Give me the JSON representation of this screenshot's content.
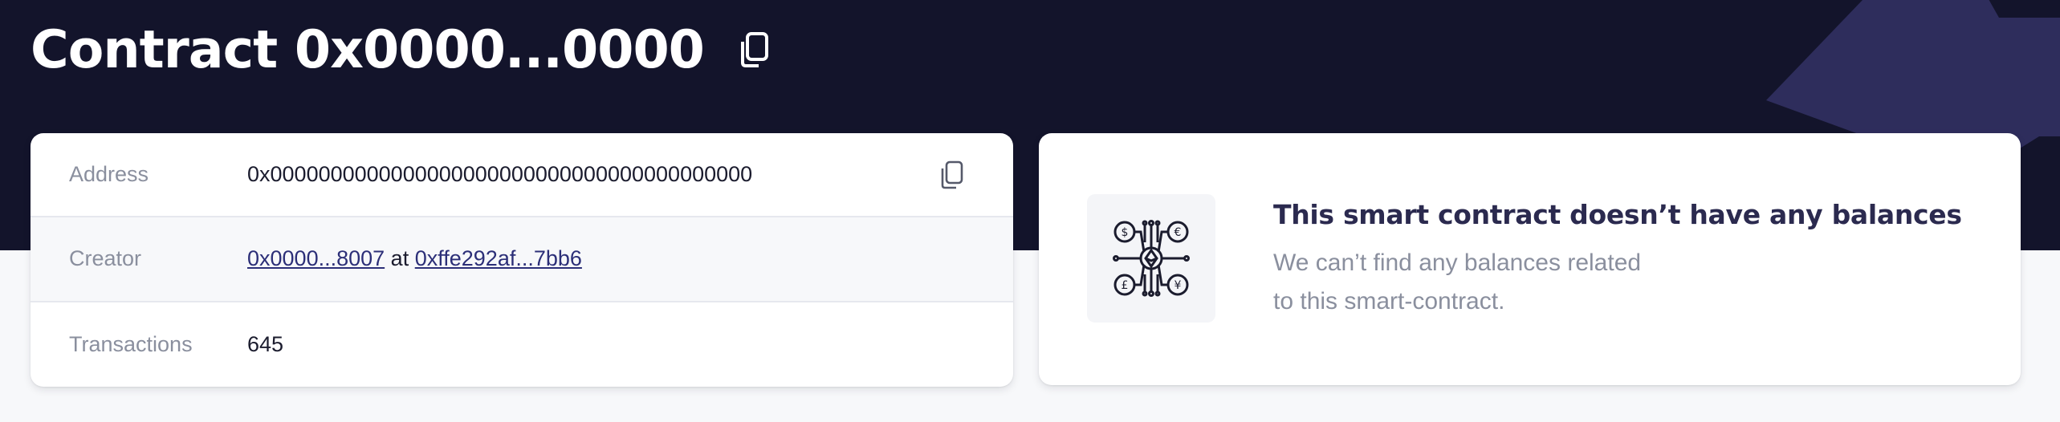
{
  "header": {
    "title": "Contract 0x0000...0000",
    "copy_icon": "copy-icon"
  },
  "info": {
    "rows": [
      {
        "label": "Address",
        "value": "0x0000000000000000000000000000000000000000",
        "copy_icon": "copy-icon"
      },
      {
        "label": "Creator",
        "creator_link": "0x0000...8007",
        "connector": "at",
        "tx_link": "0xffe292af...7bb6"
      },
      {
        "label": "Transactions",
        "value": "645"
      }
    ]
  },
  "balances": {
    "icon": "crypto-currencies-icon",
    "title": "This smart contract doesn’t have any balances",
    "line1": "We can’t find any balances related",
    "line2": "to this smart-contract."
  },
  "colors": {
    "header_bg": "#13142b",
    "link": "#2c2f78",
    "muted": "#8a8f9e"
  }
}
